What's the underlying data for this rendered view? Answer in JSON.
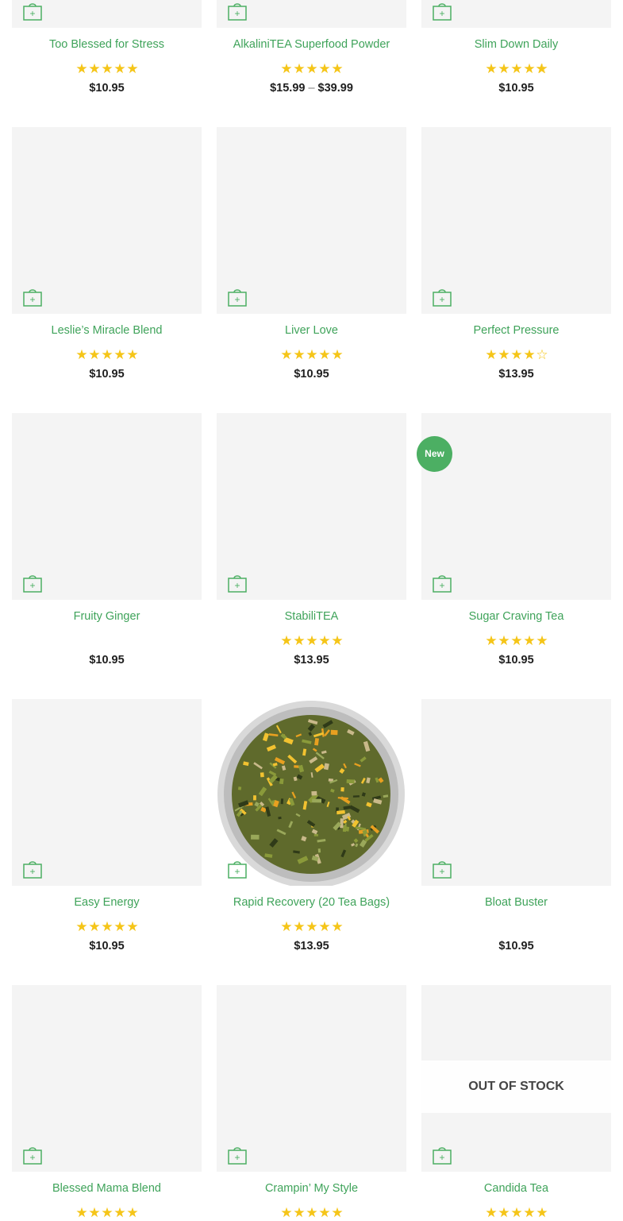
{
  "products": [
    {
      "title": "Too Blessed for Stress",
      "rating": 5,
      "price": "$10.95",
      "price_high": null,
      "badge": null,
      "out_of_stock": null,
      "photo": false,
      "add_to_cart": "+"
    },
    {
      "title": "AlkaliniTEA Superfood Powder",
      "rating": 5,
      "price": "$15.99",
      "price_high": "$39.99",
      "badge": null,
      "out_of_stock": null,
      "photo": false,
      "add_to_cart": "+"
    },
    {
      "title": "Slim Down Daily",
      "rating": 4.9,
      "price": "$10.95",
      "price_high": null,
      "badge": null,
      "out_of_stock": null,
      "photo": false,
      "add_to_cart": "+"
    },
    {
      "title": "Leslie’s Miracle Blend",
      "rating": 5,
      "price": "$10.95",
      "price_high": null,
      "badge": null,
      "out_of_stock": null,
      "photo": false,
      "add_to_cart": "+"
    },
    {
      "title": "Liver Love",
      "rating": 5,
      "price": "$10.95",
      "price_high": null,
      "badge": null,
      "out_of_stock": null,
      "photo": false,
      "add_to_cart": "+"
    },
    {
      "title": "Perfect Pressure",
      "rating": 4,
      "price": "$13.95",
      "price_high": null,
      "badge": null,
      "out_of_stock": null,
      "photo": false,
      "add_to_cart": "+"
    },
    {
      "title": "Fruity Ginger",
      "rating": null,
      "price": "$10.95",
      "price_high": null,
      "badge": null,
      "out_of_stock": null,
      "photo": false,
      "add_to_cart": "+"
    },
    {
      "title": "StabiliTEA",
      "rating": 5,
      "price": "$13.95",
      "price_high": null,
      "badge": null,
      "out_of_stock": null,
      "photo": false,
      "add_to_cart": "+"
    },
    {
      "title": "Sugar Craving Tea",
      "rating": 5,
      "price": "$10.95",
      "price_high": null,
      "badge": "New",
      "out_of_stock": null,
      "photo": false,
      "add_to_cart": "+"
    },
    {
      "title": "Easy Energy",
      "rating": 5,
      "price": "$10.95",
      "price_high": null,
      "badge": null,
      "out_of_stock": null,
      "photo": false,
      "add_to_cart": "+"
    },
    {
      "title": "Rapid Recovery (20 Tea Bags)",
      "rating": 5,
      "price": "$13.95",
      "price_high": null,
      "badge": null,
      "out_of_stock": null,
      "photo": true,
      "add_to_cart": "+"
    },
    {
      "title": "Bloat Buster",
      "rating": null,
      "price": "$10.95",
      "price_high": null,
      "badge": null,
      "out_of_stock": null,
      "photo": false,
      "add_to_cart": "+"
    },
    {
      "title": "Blessed Mama Blend",
      "rating": 5,
      "price": null,
      "price_high": null,
      "badge": null,
      "out_of_stock": null,
      "photo": false,
      "add_to_cart": "+"
    },
    {
      "title": "Crampin’ My Style",
      "rating": 5,
      "price": null,
      "price_high": null,
      "badge": null,
      "out_of_stock": null,
      "photo": false,
      "add_to_cart": "+"
    },
    {
      "title": "Candida Tea",
      "rating": 5,
      "price": null,
      "price_high": null,
      "badge": null,
      "out_of_stock": "OUT OF STOCK",
      "photo": false,
      "add_to_cart": "+"
    }
  ],
  "price_separator": "–",
  "colors": {
    "accent": "#4caf63",
    "title_link": "#3fa35a",
    "star": "#f5c518",
    "image_bg": "#f4f4f4"
  },
  "icons": {
    "cart": "shopping-bag-icon",
    "star": "star-icon",
    "badge": "new-badge"
  }
}
